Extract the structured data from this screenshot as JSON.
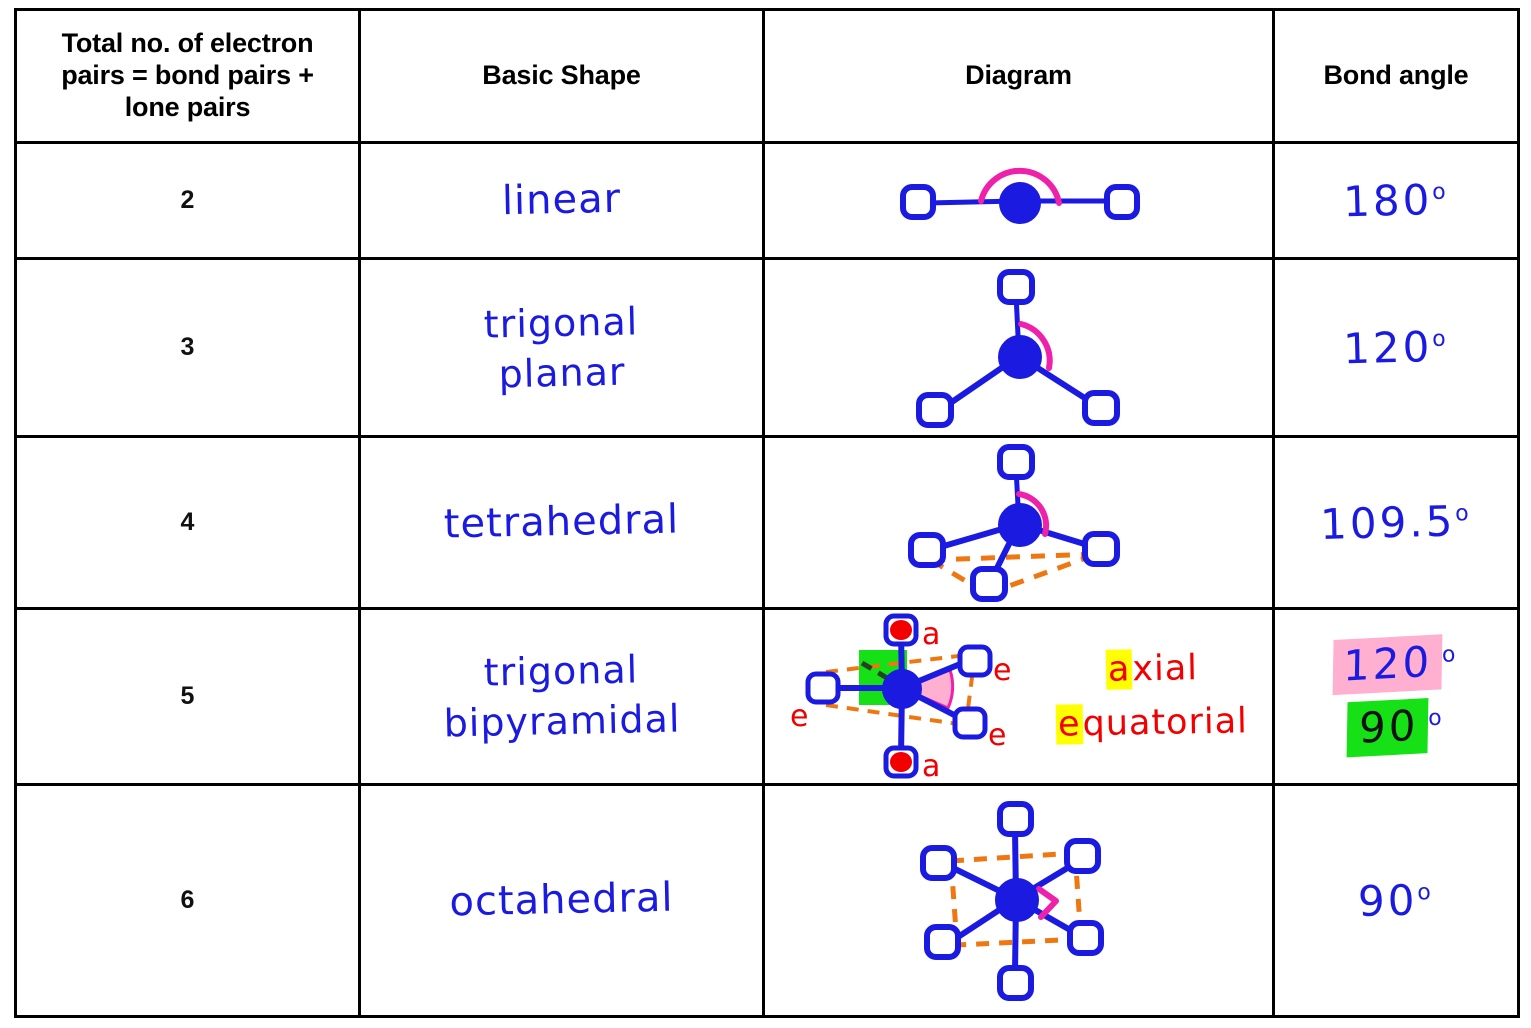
{
  "table": {
    "headers": [
      "Total no. of electron pairs = bond pairs + lone pairs",
      "Basic Shape",
      "Diagram",
      "Bond angle"
    ],
    "header_lines": {
      "count": [
        "Total no. of electron",
        "pairs = bond pairs +",
        "lone pairs"
      ],
      "shape": "Basic Shape",
      "diagram": "Diagram",
      "angle": "Bond angle"
    },
    "rows": [
      {
        "count": "2",
        "shape": "linear",
        "shape_line1": "linear",
        "shape_line2": "",
        "diagram": "linear-molecule-diagram",
        "angle": "180",
        "angle_degree": "o"
      },
      {
        "count": "3",
        "shape": "trigonal planar",
        "shape_line1": "trigonal",
        "shape_line2": "planar",
        "diagram": "trigonal-planar-molecule-diagram",
        "angle": "120",
        "angle_degree": "o"
      },
      {
        "count": "4",
        "shape": "tetrahedral",
        "shape_line1": "tetrahedral",
        "shape_line2": "",
        "diagram": "tetrahedral-molecule-diagram",
        "angle": "109.5",
        "angle_degree": "o"
      },
      {
        "count": "5",
        "shape": "trigonal bipyramidal",
        "shape_line1": "trigonal",
        "shape_line2": "bipyramidal",
        "diagram": "trigonal-bipyramidal-molecule-diagram",
        "angle": "120",
        "angle_degree": "o",
        "angle2": "90",
        "angle2_degree": "o"
      },
      {
        "count": "6",
        "shape": "octahedral",
        "shape_line1": "octahedral",
        "shape_line2": "",
        "diagram": "octahedral-molecule-diagram",
        "angle": "90",
        "angle_degree": "o"
      }
    ]
  },
  "legend": {
    "axial_key": "a",
    "axial_rest": "xial",
    "equatorial_key": "e",
    "equatorial_rest": "quatorial",
    "axial_full": "axial",
    "equatorial_full": "equatorial",
    "atom_labels": {
      "axial_top": "a",
      "axial_bottom": "a",
      "equatorial_left": "e",
      "equatorial_upper_right": "e",
      "equatorial_lower_right": "e"
    }
  },
  "colors": {
    "bond_blue": "#1a1ae0",
    "central_atom": "#1a1ae0",
    "dashed_orange": "#ee7711",
    "angle_magenta": "#ee22aa",
    "angle_pink_fill": "#ffafd0",
    "axial_red": "#f20000",
    "highlight_yellow": "#ffff00",
    "highlight_green": "#16e016",
    "highlight_pink": "#ffafd0",
    "table_border": "#000000",
    "background": "#ffffff"
  }
}
